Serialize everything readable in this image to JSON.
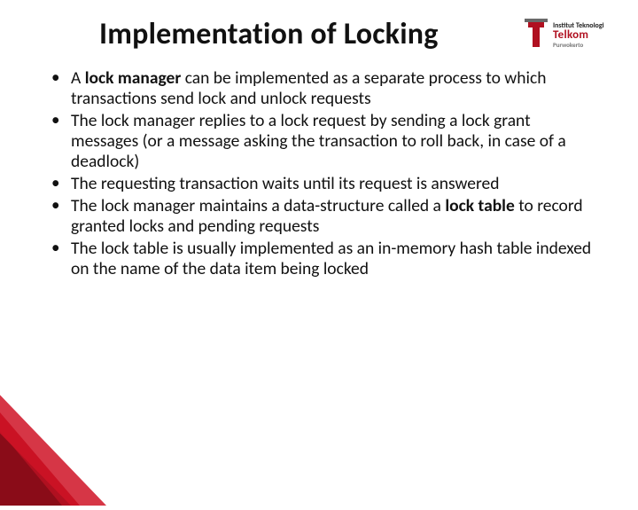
{
  "title": "Implementation of Locking",
  "logo": {
    "line1": "Institut Teknologi",
    "line2": "Telkom",
    "line3": "Purwokerto"
  },
  "bullets": [
    {
      "pre": "A ",
      "bold1": "lock manager",
      "mid": " can be implemented as a separate process to which transactions send lock and unlock requests",
      "bold2": "",
      "post": ""
    },
    {
      "pre": "The lock manager replies to a lock request by sending a lock grant messages (or a message asking the transaction to roll back, in case of  a deadlock)",
      "bold1": "",
      "mid": "",
      "bold2": "",
      "post": ""
    },
    {
      "pre": "The requesting transaction waits until its request is answered",
      "bold1": "",
      "mid": "",
      "bold2": "",
      "post": ""
    },
    {
      "pre": "The lock manager maintains a data-structure called a ",
      "bold1": "lock table",
      "mid": " to record granted locks and pending requests",
      "bold2": "",
      "post": ""
    },
    {
      "pre": "The lock table is usually implemented as an in-memory hash table indexed on the name of the data item being locked",
      "bold1": "",
      "mid": "",
      "bold2": "",
      "post": ""
    }
  ]
}
